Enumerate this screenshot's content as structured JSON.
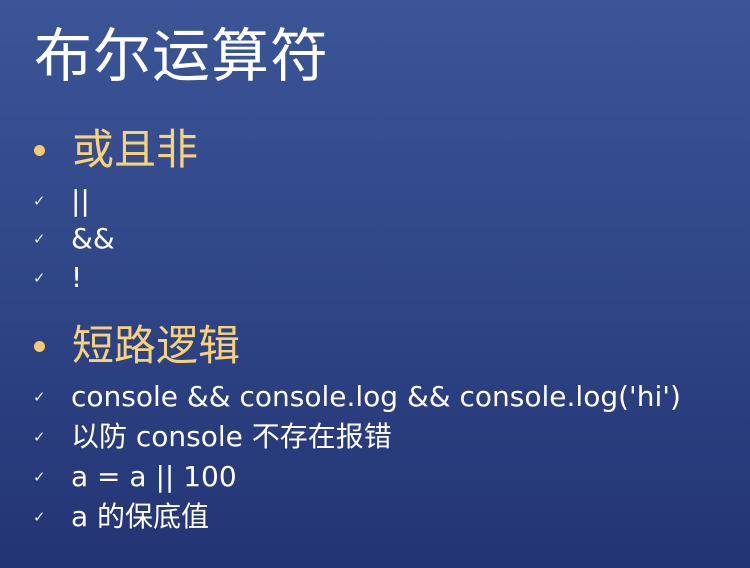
{
  "slide": {
    "title": "布尔运算符",
    "sections": [
      {
        "heading": "或且非",
        "items": [
          "||",
          "&&",
          "!"
        ]
      },
      {
        "heading": "短路逻辑",
        "items": [
          "console && console.log && console.log('hi')",
          "以防 console 不存在报错",
          "a = a || 100",
          "a 的保底值"
        ]
      }
    ],
    "check_glyph": "✓",
    "colors": {
      "background_top": "#3b5596",
      "background_bottom": "#233474",
      "heading": "#f7d27a",
      "text": "#ffffff"
    }
  }
}
